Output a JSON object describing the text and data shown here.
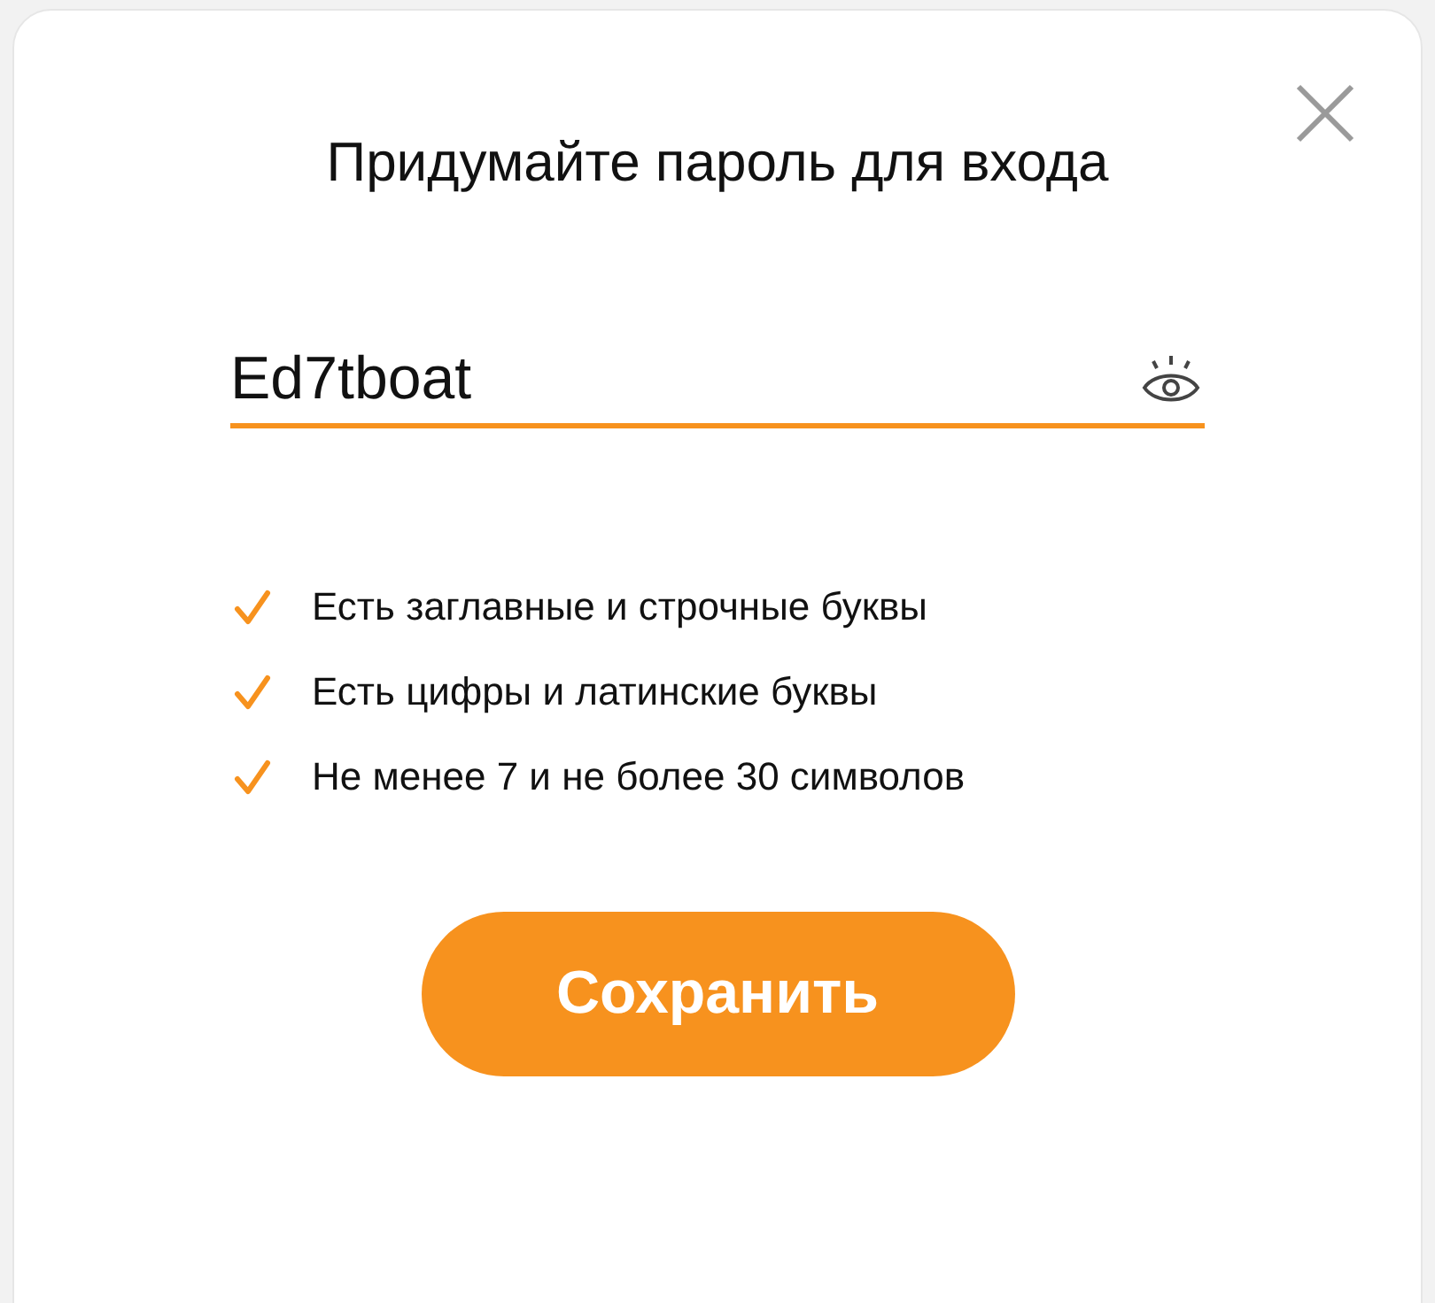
{
  "dialog": {
    "title": "Придумайте пароль для входа"
  },
  "password_field": {
    "value": "Ed7tboat",
    "visible": true
  },
  "requirements": [
    {
      "text": "Есть заглавные и строчные буквы",
      "checked": true
    },
    {
      "text": "Есть цифры и латинские буквы",
      "checked": true
    },
    {
      "text": "Не менее 7 и не более 30 символов",
      "checked": true
    }
  ],
  "save_button": {
    "label": "Сохранить"
  }
}
